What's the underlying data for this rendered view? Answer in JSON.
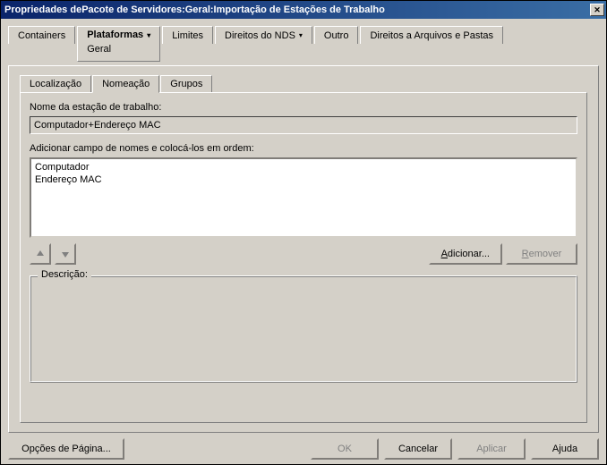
{
  "title": "Propriedades dePacote de Servidores:Geral:Importação de Estações de Trabalho",
  "topTabs": {
    "containers": "Containers",
    "plataformas": "Plataformas",
    "plataformas_sub": "Geral",
    "limites": "Limites",
    "direitosNDS": "Direitos do NDS",
    "outro": "Outro",
    "direitosArquivos": "Direitos a Arquivos e Pastas"
  },
  "innerTabs": {
    "localizacao": "Localização",
    "nomeacao": "Nomeação",
    "grupos": "Grupos"
  },
  "labels": {
    "nomeEstacao": "Nome da estação de trabalho:",
    "adicionarCampo": "Adicionar campo de nomes e colocá-los em ordem:",
    "descricao": "Descrição:"
  },
  "fields": {
    "nomeEstacaoValue": "Computador+Endereço MAC"
  },
  "listItems": [
    "Computador",
    "Endereço MAC"
  ],
  "buttons": {
    "adicionar": "Adicionar...",
    "remover": "Remover",
    "opcoesPagina": "Opções de Página...",
    "ok": "OK",
    "cancelar": "Cancelar",
    "aplicar": "Aplicar",
    "ajuda": "Ajuda"
  }
}
